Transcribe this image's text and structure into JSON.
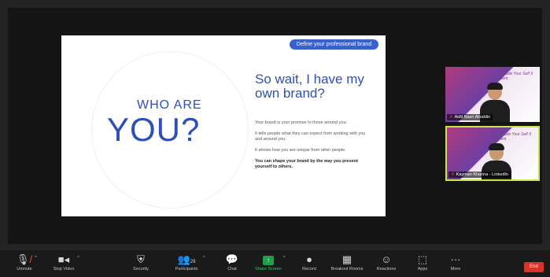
{
  "slide": {
    "tag": "Define your professional brand",
    "who": "WHO ARE",
    "you": "YOU?",
    "heading": "So wait, I have my own brand?",
    "paragraphs": [
      "Your brand is your promise to those around you.",
      "It tells people what they can expect from working with you and around you.",
      "It shows how you are unique from other people."
    ],
    "bold": "You can shape your brand by the way you present yourself to others."
  },
  "participants": [
    {
      "name": "Aidil Nazri Aliuddin",
      "muted": true,
      "decor": "Upgrade Your Self X Talent"
    },
    {
      "name": "Kayman Khanna - LinkedIn",
      "muted": true,
      "decor": "Upgrade Your Self X Talent"
    }
  ],
  "toolbar": {
    "unmute": "Unmute",
    "stop_video": "Stop Video",
    "security": "Security",
    "participants": "Participants",
    "participants_count": "29",
    "chat": "Chat",
    "share_screen": "Share Screen",
    "record": "Record",
    "breakout": "Breakout Rooms",
    "reactions": "Reactions",
    "apps": "Apps",
    "more": "More",
    "end": "End"
  },
  "colors": {
    "accent": "#2e4fb8",
    "share_green": "#20a04a",
    "end_red": "#d9342b",
    "active_speaker": "#c9e54a"
  }
}
